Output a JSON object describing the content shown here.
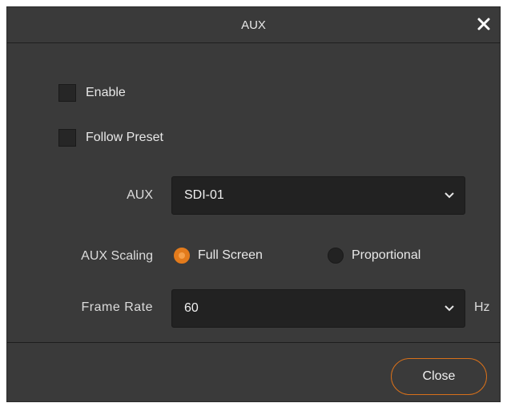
{
  "dialog": {
    "title": "AUX",
    "close_icon": "close-icon"
  },
  "options": {
    "enable_label": "Enable",
    "enable_checked": false,
    "follow_preset_label": "Follow Preset",
    "follow_preset_checked": false
  },
  "aux": {
    "label": "AUX",
    "selected": "SDI-01"
  },
  "scaling": {
    "label": "AUX Scaling",
    "options": [
      {
        "label": "Full Screen",
        "checked": true
      },
      {
        "label": "Proportional",
        "checked": false
      }
    ]
  },
  "frame_rate": {
    "label": "Frame Rate",
    "selected": "60",
    "unit": "Hz"
  },
  "footer": {
    "close_label": "Close"
  },
  "colors": {
    "accent": "#e37b1c",
    "background": "#3a3a3a",
    "field": "#222222"
  }
}
